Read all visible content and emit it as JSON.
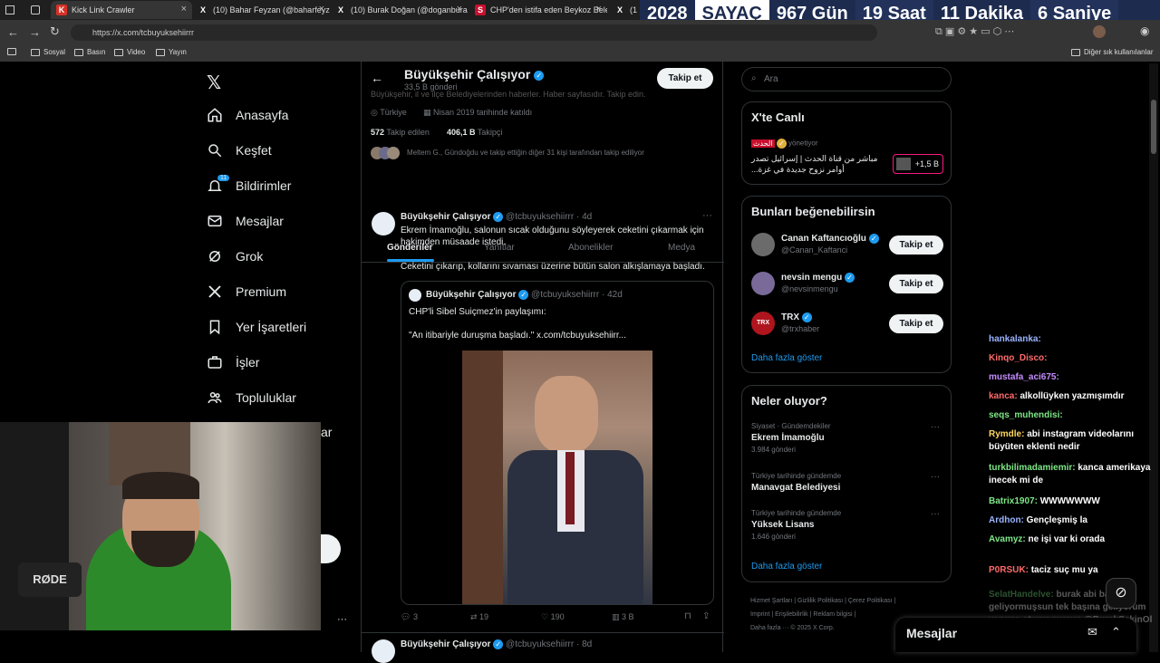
{
  "browser": {
    "tabs": [
      {
        "label": "Kick Link Crawler",
        "fav": "K",
        "color": "#d93025"
      },
      {
        "label": "(10) Bahar Feyzan (@baharfeyza",
        "fav": "X",
        "color": "#000"
      },
      {
        "label": "(10) Burak Doğan (@doganbura",
        "fav": "X",
        "color": "#000"
      },
      {
        "label": "CHP'den istifa eden Beykoz Bele",
        "fav": "S",
        "color": "#c8102e"
      },
      {
        "label": "(1",
        "fav": "X",
        "color": "#000"
      }
    ],
    "url": "https://x.com/tcbuyuksehiirrr",
    "bookmarks": [
      "Sosyal",
      "Basın",
      "Video",
      "Yayın"
    ],
    "bookmarks_right": "Diğer sık kullanılanlar"
  },
  "counter": {
    "year": "2028",
    "label": "SAYAÇ",
    "days": "967 Gün",
    "hours": "19 Saat",
    "minutes": "11 Dakika",
    "seconds": "6 Saniye"
  },
  "nav": {
    "items": [
      {
        "label": "Anasayfa",
        "icon": "home-icon"
      },
      {
        "label": "Keşfet",
        "icon": "search-icon"
      },
      {
        "label": "Bildirimler",
        "icon": "bell-icon",
        "badge": "11"
      },
      {
        "label": "Mesajlar",
        "icon": "mail-icon"
      },
      {
        "label": "Grok",
        "icon": "grok-icon"
      },
      {
        "label": "Premium",
        "icon": "x-icon"
      },
      {
        "label": "Yer İşaretleri",
        "icon": "bookmark-icon"
      },
      {
        "label": "İşler",
        "icon": "briefcase-icon"
      },
      {
        "label": "Topluluklar",
        "icon": "people-icon"
      }
    ],
    "hidden_partial": "ar"
  },
  "profile": {
    "name": "Büyükşehir Çalışıyor",
    "posts": "33,5 B gönderi",
    "bio": "Büyükşehir, il ve ilçe Belediyelerinden haberler. Haber sayfasıdır. Takip edin.",
    "location": "Türkiye",
    "joined": "Nisan 2019 tarihinde katıldı",
    "following_count": "572",
    "following_label": "Takip edilen",
    "followers_count": "406,1 B",
    "followers_label": "Takipçi",
    "followed_by": "Meltem G., Gündoğdu ve takip ettiğin diğer 31 kişi tarafından takip ediliyor",
    "follow_button": "Takip et",
    "tabs": [
      "Gönderiler",
      "Yanıtlar",
      "Abonelikler",
      "Medya"
    ]
  },
  "tweet": {
    "name": "Büyükşehir Çalışıyor",
    "handle": "@tcbuyuksehiirrr",
    "time": "· 4d",
    "text1": "Ekrem İmamoğlu, salonun sıcak olduğunu söyleyerek ceketini çıkarmak için hakimden müsaade istedi.",
    "text2": "Ceketini çıkarıp, kollarını sıvaması üzerine bütün salon alkışlamaya başladı.",
    "quote": {
      "name": "Büyükşehir Çalışıyor",
      "handle": "@tcbuyuksehiirrr",
      "time": "· 42d",
      "text1": "CHP'li Sibel Suiçmez'in paylaşımı:",
      "text2": "\"An itibariyle duruşma başladı.\" x.com/tcbuyuksehiirr..."
    },
    "stats": {
      "replies": "3",
      "retweets": "19",
      "likes": "190",
      "views": "3 B"
    }
  },
  "tweet2": {
    "name": "Büyükşehir Çalışıyor",
    "handle": "@tcbuyuksehiirrr",
    "time": "· 8d"
  },
  "right": {
    "search_placeholder": "Ara",
    "live": {
      "title": "X'te Canlı",
      "host": "الحدث",
      "host_role": "yönetiyor",
      "text": "مباشر من قناة الحدث | إسرائيل تصدر أوامر نزوح جديدة في غزة...",
      "viewers": "+1,5 B"
    },
    "suggest": {
      "title": "Bunları beğenebilirsin",
      "users": [
        {
          "name": "Canan Kaftancıoğlu",
          "handle": "@Canan_Kaftanci",
          "button": "Takip et"
        },
        {
          "name": "nevsin mengu",
          "handle": "@nevsinmengu",
          "button": "Takip et"
        },
        {
          "name": "TRX",
          "handle": "@trxhaber",
          "button": "Takip et"
        }
      ],
      "more": "Daha fazla göster"
    },
    "trends": {
      "title": "Neler oluyor?",
      "items": [
        {
          "context": "Siyaset · Gündemdekiler",
          "name": "Ekrem İmamoğlu",
          "count": "3.984 gönderi"
        },
        {
          "context": "Türkiye tarihinde gündemde",
          "name": "Manavgat Belediyesi",
          "count": ""
        },
        {
          "context": "Türkiye tarihinde gündemde",
          "name": "Yüksek Lisans",
          "count": "1.646 gönderi"
        }
      ],
      "more": "Daha fazla göster"
    },
    "footer": [
      "Hizmet Şartları",
      "Gizlilik Politikası",
      "Çerez Politikası",
      "Imprint",
      "Erişilebilirlik",
      "Reklam bilgisi",
      "Daha fazla ···",
      "© 2025 X Corp."
    ]
  },
  "messages_drawer": "Mesajlar",
  "chat": [
    {
      "user": "hankalanka:",
      "text": "",
      "color": "#9ab4ff"
    },
    {
      "user": "Kinqo_Disco:",
      "text": "",
      "color": "#ff6b6b"
    },
    {
      "user": "mustafa_aci675:",
      "text": "",
      "color": "#c68cff"
    },
    {
      "user": "kanca:",
      "text": "alkollüyken yazmışımdır",
      "color": "#ff6b6b"
    },
    {
      "user": "seqs_muhendisi:",
      "text": "",
      "color": "#7ee787"
    },
    {
      "user": "Rymdle:",
      "text": "abi instagram videolarını büyüten eklenti nedir",
      "color": "#ffd75e"
    },
    {
      "user": "turkbilimadamiemir:",
      "text": "kanca amerikaya inecek mi de",
      "color": "#7ee787"
    },
    {
      "user": "Batrix1907:",
      "text": "WWWWWWW",
      "color": "#7ee787"
    },
    {
      "user": "Ardhon:",
      "text": "Gençleşmiş la",
      "color": "#9ab4ff"
    },
    {
      "user": "Avamyz:",
      "text": "ne işi var ki orada",
      "color": "#7ee787"
    },
    {
      "user": "P0RSUK:",
      "text": "taciz suç mu ya",
      "color": "#ff6b6b"
    },
    {
      "user": "SelatHandelve:",
      "text": "burak abi ba geliyormuşsun tek başına geliyorum yanıma oturur musun @BurakSakinOl",
      "color": "#7ee787"
    }
  ],
  "webcam": {
    "mic_brand": "RØDE"
  }
}
